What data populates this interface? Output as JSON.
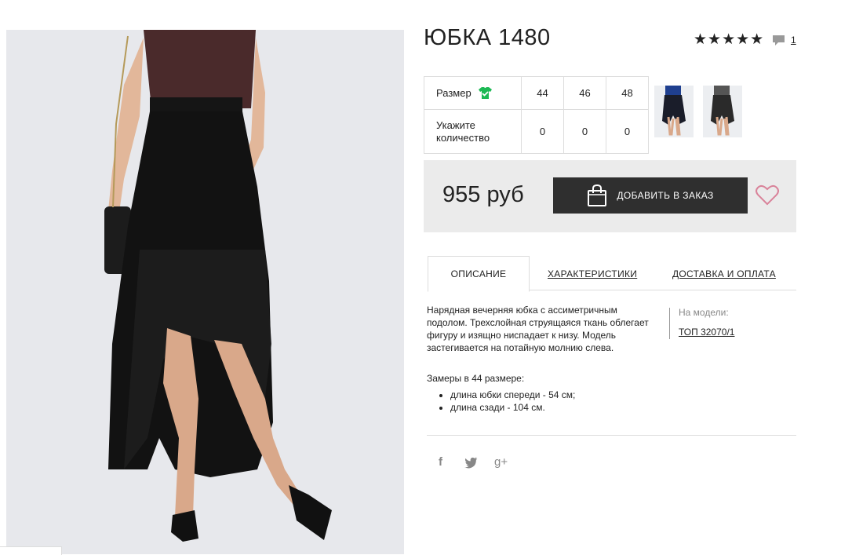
{
  "product": {
    "title": "ЮБКА 1480",
    "rating_stars": "★★★★★",
    "review_count": "1"
  },
  "sizes": {
    "size_label": "Размер",
    "qty_label": "Укажите количество",
    "columns": [
      "44",
      "46",
      "48"
    ],
    "quantities": [
      "0",
      "0",
      "0"
    ]
  },
  "price": {
    "amount": "955 руб",
    "add_button": "ДОБАВИТЬ В ЗАКАЗ"
  },
  "tabs": {
    "description": "ОПИСАНИЕ",
    "specs": "ХАРАКТЕРИСТИКИ",
    "delivery": "ДОСТАВКА И ОПЛАТА"
  },
  "description": {
    "text": "Нарядная вечерняя юбка с ассиметричным подолом. Трехслойная струящаяся ткань облегает фигуру и изящно ниспадает к низу. Модель застегивается на потайную молнию слева.",
    "measure_title": "Замеры в 44 размере:",
    "measures": [
      "длина юбки спереди - 54 см;",
      "длина сзади - 104 см."
    ],
    "model_label": "На модели:",
    "model_link": "ТОП 32070/1"
  },
  "social": {
    "facebook": "f",
    "twitter": "🐦",
    "googleplus": "g+"
  },
  "colors": {
    "accent_green": "#1db954",
    "heart_pink": "#d9839a",
    "button_dark": "#2f2f2f",
    "price_box": "#ebebeb"
  }
}
